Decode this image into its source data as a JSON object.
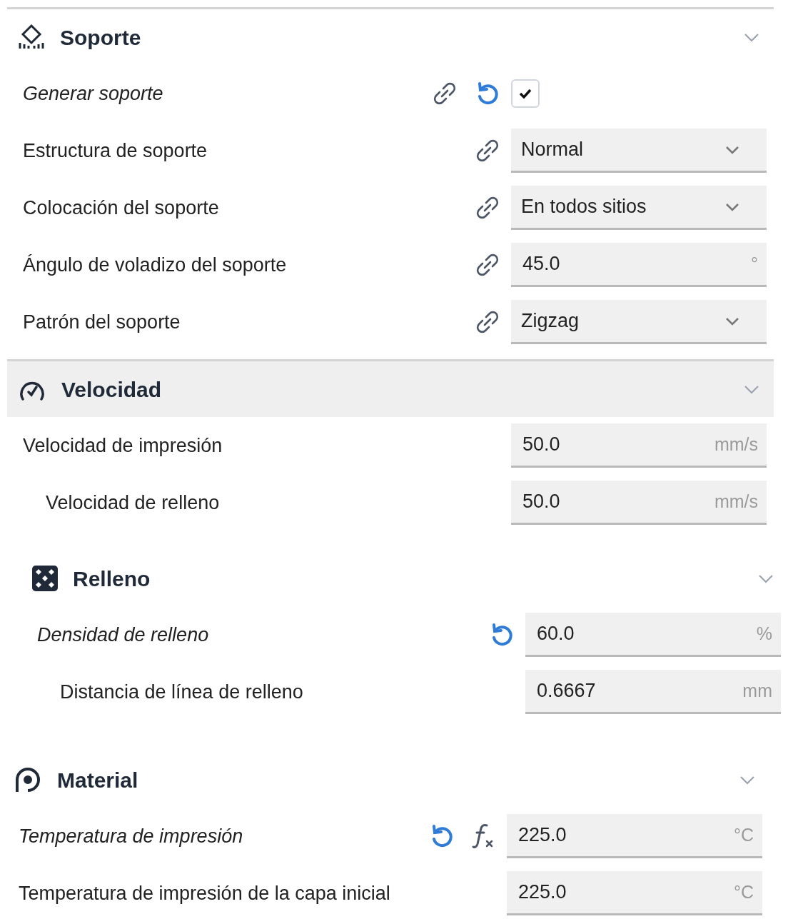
{
  "sections": [
    {
      "title": "Soporte",
      "kind": "support",
      "highlighted": false,
      "divider": true,
      "expanded": true,
      "settings": [
        {
          "label": "Generar soporte",
          "modified": true,
          "linked": true,
          "resettable": true,
          "formula": false,
          "kind": "checkbox",
          "checked": true
        },
        {
          "label": "Estructura de soporte",
          "modified": false,
          "linked": true,
          "resettable": false,
          "formula": false,
          "kind": "dropdown",
          "value": "Normal"
        },
        {
          "label": "Colocación del soporte",
          "modified": false,
          "linked": true,
          "resettable": false,
          "formula": false,
          "kind": "dropdown",
          "value": "En todos sitios"
        },
        {
          "label": "Ángulo de voladizo del soporte",
          "modified": false,
          "linked": true,
          "resettable": false,
          "formula": false,
          "kind": "number",
          "value": "45.0",
          "unit": "°"
        },
        {
          "label": "Patrón del soporte",
          "modified": false,
          "linked": true,
          "resettable": false,
          "formula": false,
          "kind": "dropdown",
          "value": "Zigzag"
        }
      ]
    },
    {
      "title": "Velocidad",
      "kind": "gauge",
      "highlighted": true,
      "divider": true,
      "expanded": true,
      "settings": [
        {
          "label": "Velocidad de impresión",
          "modified": false,
          "linked": false,
          "resettable": false,
          "formula": false,
          "kind": "number",
          "value": "50.0",
          "unit": "mm/s",
          "children": [
            {
              "label": "Velocidad de relleno",
              "modified": false,
              "linked": false,
              "resettable": false,
              "formula": false,
              "kind": "number",
              "value": "50.0",
              "unit": "mm/s"
            }
          ]
        }
      ]
    },
    {
      "title": "Relleno",
      "kind": "infill",
      "highlighted": false,
      "divider": false,
      "expanded": true,
      "settings": [
        {
          "label": "Densidad de relleno",
          "modified": true,
          "linked": false,
          "resettable": true,
          "formula": false,
          "kind": "number",
          "value": "60.0",
          "unit": "%",
          "children": [
            {
              "label": "Distancia de línea de relleno",
              "modified": false,
              "linked": false,
              "resettable": false,
              "formula": false,
              "kind": "number",
              "value": "0.6667",
              "unit": "mm"
            }
          ]
        }
      ]
    },
    {
      "title": "Material",
      "kind": "spool",
      "highlighted": false,
      "divider": false,
      "expanded": true,
      "settings": [
        {
          "label": "Temperatura de impresión",
          "modified": true,
          "linked": false,
          "resettable": true,
          "formula": true,
          "kind": "number",
          "value": "225.0",
          "unit": "°C"
        },
        {
          "label": "Temperatura de impresión de la capa inicial",
          "modified": false,
          "linked": false,
          "resettable": false,
          "formula": false,
          "kind": "number",
          "value": "225.0",
          "unit": "°C"
        }
      ]
    }
  ]
}
